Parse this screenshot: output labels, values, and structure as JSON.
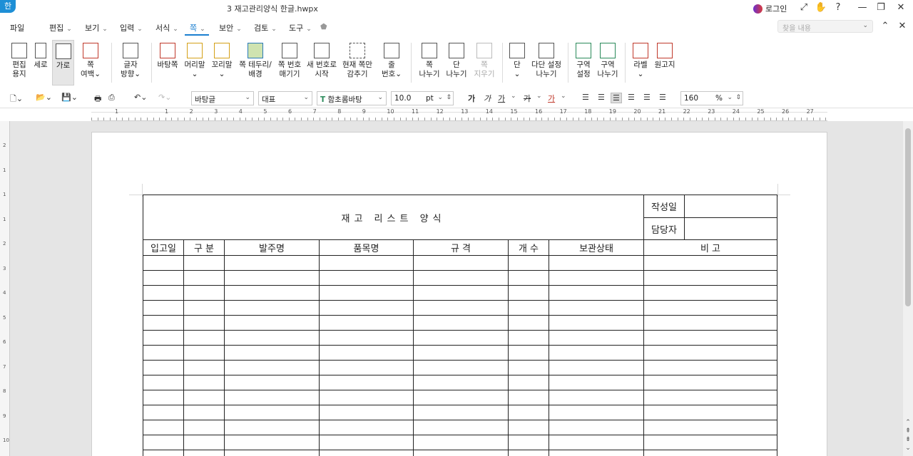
{
  "window": {
    "doc_title": "3 재고관리양식 한글.hwpx",
    "app_logo": "한",
    "login": "로그인",
    "controls": [
      "⤢",
      "✋",
      "?",
      "—",
      "❐",
      "✕"
    ]
  },
  "menubar": {
    "items": [
      "파일",
      "편집",
      "보기",
      "입력",
      "서식",
      "쪽",
      "보안",
      "검토",
      "도구"
    ],
    "active": "쪽",
    "search_placeholder": "찾을 내용"
  },
  "ribbon": {
    "buttons": [
      {
        "l1": "편집",
        "l2": "용지"
      },
      {
        "l1": "세로",
        "l2": ""
      },
      {
        "l1": "가로",
        "l2": ""
      },
      {
        "l1": "쪽",
        "l2": "여백⌄"
      },
      {
        "l1": "글자",
        "l2": "방향⌄"
      },
      {
        "l1": "바탕쪽",
        "l2": ""
      },
      {
        "l1": "머리말",
        "l2": "⌄"
      },
      {
        "l1": "꼬리말",
        "l2": "⌄"
      },
      {
        "l1": "쪽 테두리/",
        "l2": "배경"
      },
      {
        "l1": "쪽 번호",
        "l2": "매기기"
      },
      {
        "l1": "새 번호로",
        "l2": "시작"
      },
      {
        "l1": "현재 쪽만",
        "l2": "감추기"
      },
      {
        "l1": "줄",
        "l2": "번호⌄"
      },
      {
        "l1": "쪽",
        "l2": "나누기"
      },
      {
        "l1": "단",
        "l2": "나누기"
      },
      {
        "l1": "쪽",
        "l2": "지우기"
      },
      {
        "l1": "단",
        "l2": "⌄"
      },
      {
        "l1": "다단 설정",
        "l2": "나누기"
      },
      {
        "l1": "구역",
        "l2": "설정"
      },
      {
        "l1": "구역",
        "l2": "나누기"
      },
      {
        "l1": "라벨",
        "l2": "⌄"
      },
      {
        "l1": "원고지",
        "l2": ""
      }
    ]
  },
  "format_bar": {
    "style": "바탕글",
    "lang": "대표",
    "font": "함초롬바탕",
    "size": "10.0",
    "size_unit": "pt",
    "char_buttons": [
      "가",
      "가",
      "가",
      "가",
      "가"
    ],
    "zoom": "160",
    "zoom_unit": "%"
  },
  "ruler": {
    "numbers": [
      "1",
      "1",
      "2",
      "3",
      "4",
      "5",
      "6",
      "7",
      "8",
      "9",
      "10",
      "11",
      "12",
      "13",
      "14",
      "15",
      "16",
      "17",
      "18",
      "19",
      "20",
      "21",
      "22",
      "23",
      "24",
      "25",
      "26",
      "27"
    ],
    "vnumbers": [
      "2",
      "1",
      "1",
      "1",
      "2",
      "3",
      "4",
      "5",
      "6",
      "7",
      "8",
      "9",
      "10"
    ]
  },
  "document": {
    "title": "재고 리스트 양식",
    "meta_labels": [
      "작성일",
      "담당자"
    ],
    "headers": [
      "입고일",
      "구 분",
      "발주명",
      "품목명",
      "규 격",
      "개 수",
      "보관상태",
      "비 고"
    ],
    "empty_rows": 14
  }
}
